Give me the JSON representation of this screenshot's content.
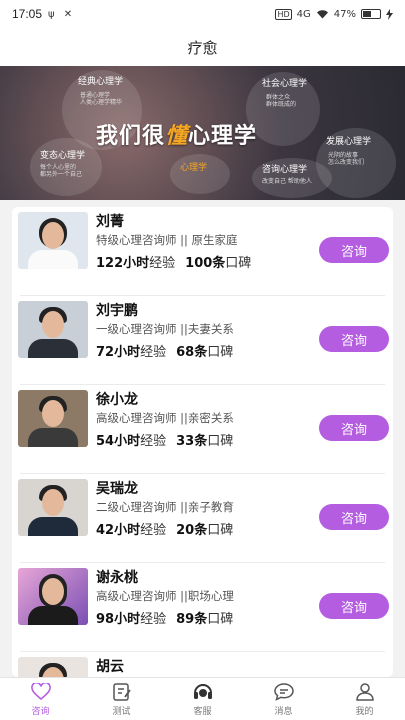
{
  "status_bar": {
    "time": "17:05",
    "left_icons": "ψ ✕",
    "hd": "HD",
    "signal": "4G",
    "battery_percent": "47%"
  },
  "header": {
    "title": "疗愈"
  },
  "banner": {
    "main_prefix": "我们很",
    "main_accent": "懂",
    "main_suffix": "心理学",
    "tags": [
      {
        "title": "经典心理学",
        "sub": "普通心理学\n人类心理学精华"
      },
      {
        "title": "社会心理学",
        "sub": "群体之众\n群体既成的"
      },
      {
        "title": "变态心理学",
        "sub": "每个人心里的\n都另外一个自己"
      },
      {
        "title": "发展心理学",
        "sub": "光阴的故事\n怎么改变我们"
      },
      {
        "title": "心理学",
        "sub": ""
      },
      {
        "title": "咨询心理学",
        "sub": "改变自己 帮助他人"
      }
    ]
  },
  "consultants": [
    {
      "name": "刘菁",
      "title": "特级心理咨询师 || 原生家庭",
      "hours": "122小时",
      "hours_unit": "经验",
      "reviews": "100条",
      "reviews_unit": "口碑",
      "button": "咨询"
    },
    {
      "name": "刘宇鹏",
      "title": "一级心理咨询师 ||夫妻关系",
      "hours": "72小时",
      "hours_unit": "经验",
      "reviews": "68条",
      "reviews_unit": "口碑",
      "button": "咨询"
    },
    {
      "name": "徐小龙",
      "title": "高级心理咨询师 ||亲密关系",
      "hours": "54小时",
      "hours_unit": "经验",
      "reviews": "33条",
      "reviews_unit": "口碑",
      "button": "咨询"
    },
    {
      "name": "吴瑞龙",
      "title": "二级心理咨询师 ||亲子教育",
      "hours": "42小时",
      "hours_unit": "经验",
      "reviews": "20条",
      "reviews_unit": "口碑",
      "button": "咨询"
    },
    {
      "name": "谢永桃",
      "title": "高级心理咨询师 ||职场心理",
      "hours": "98小时",
      "hours_unit": "经验",
      "reviews": "89条",
      "reviews_unit": "口碑",
      "button": "咨询"
    },
    {
      "name": "胡云",
      "title": "",
      "hours": "",
      "hours_unit": "",
      "reviews": "",
      "reviews_unit": "",
      "button": ""
    }
  ],
  "tabs": [
    {
      "label": "咨询",
      "icon": "heart-icon",
      "active": true
    },
    {
      "label": "测试",
      "icon": "edit-note-icon",
      "active": false
    },
    {
      "label": "客服",
      "icon": "headset-icon",
      "active": false
    },
    {
      "label": "消息",
      "icon": "chat-bubble-icon",
      "active": false
    },
    {
      "label": "我的",
      "icon": "person-icon",
      "active": false
    }
  ],
  "colors": {
    "accent": "#b45de0",
    "banner_accent": "#f5a623"
  }
}
